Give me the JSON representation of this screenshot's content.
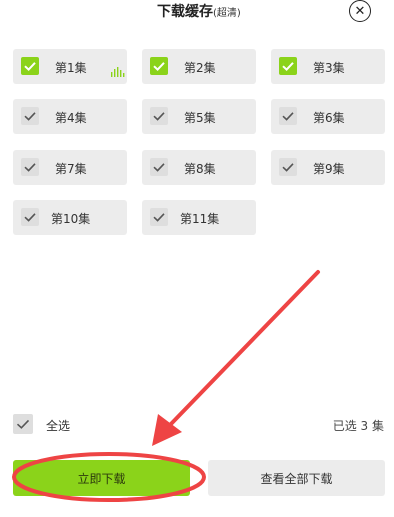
{
  "header": {
    "title": "下载缓存",
    "quality": "(超清)",
    "close_icon": "close-circle-icon"
  },
  "episodes": [
    {
      "label": "第1集",
      "checked": true,
      "playing": true
    },
    {
      "label": "第2集",
      "checked": true
    },
    {
      "label": "第3集",
      "checked": true
    },
    {
      "label": "第4集",
      "checked": false
    },
    {
      "label": "第5集",
      "checked": false
    },
    {
      "label": "第6集",
      "checked": false
    },
    {
      "label": "第7集",
      "checked": false
    },
    {
      "label": "第8集",
      "checked": false
    },
    {
      "label": "第9集",
      "checked": false
    },
    {
      "label": "第10集",
      "checked": false
    },
    {
      "label": "第11集",
      "checked": false
    }
  ],
  "footer": {
    "select_all_label": "全选",
    "selected_count": "已选 3 集",
    "download_button": "立即下载",
    "view_all_button": "查看全部下载"
  },
  "colors": {
    "accent": "#8bd31a",
    "tile_bg": "#ececec",
    "annotation_red": "#ee4444"
  }
}
